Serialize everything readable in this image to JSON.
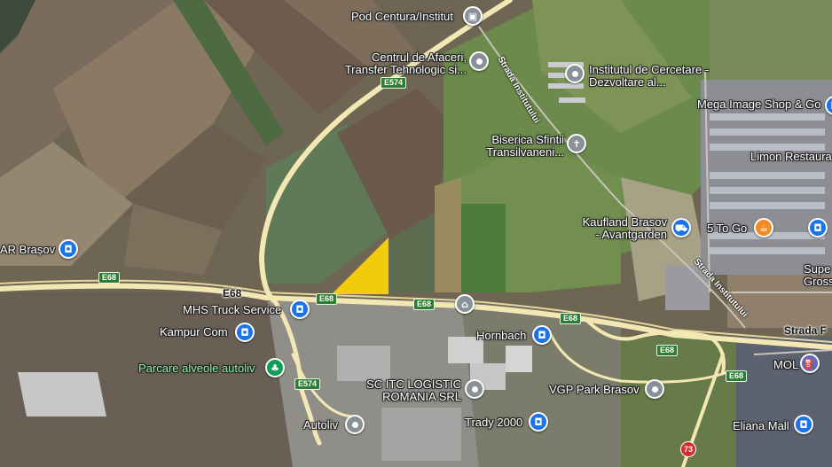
{
  "map": {
    "highlight_color": "#f2cc0c",
    "places": [
      {
        "id": "pod-centura",
        "label": "Pod Centura/Institut",
        "icon": "camera-icon",
        "color": "gray"
      },
      {
        "id": "centrul-afaceri",
        "label_lines": [
          "Centrul de Afaceri,",
          "Transfer Tehnologic si..."
        ],
        "icon": "pin-icon",
        "color": "gray"
      },
      {
        "id": "institutul",
        "label_lines": [
          "Institutul de Cercetare -",
          "Dezvoltare al..."
        ],
        "icon": "pin-icon",
        "color": "gray"
      },
      {
        "id": "mega-image",
        "label": "Mega Image Shop & Go",
        "icon": "shopping-bag-icon",
        "color": "blue"
      },
      {
        "id": "biserica",
        "label_lines": [
          "Biserica Sfintii",
          "Transilvaneni..."
        ],
        "icon": "cross-icon",
        "color": "gray"
      },
      {
        "id": "limon",
        "label": "Limon Restaura",
        "icon": "restaurant-icon",
        "color": "orange"
      },
      {
        "id": "kaufland",
        "label_lines": [
          "Kaufland Brasov",
          "- Avantgarden"
        ],
        "icon": "cart-icon",
        "color": "blue"
      },
      {
        "id": "5-to-go",
        "label": "5 To Go",
        "icon": "cafe-icon",
        "color": "orange"
      },
      {
        "id": "super-gross",
        "label_lines": [
          "Supe",
          "Gross&"
        ],
        "icon": "shopping-bag-icon",
        "color": "blue"
      },
      {
        "id": "ar-brasov",
        "label": "AR Brașov",
        "icon": "shopping-bag-icon",
        "color": "blue"
      },
      {
        "id": "mhs-truck",
        "label": "MHS Truck Service",
        "icon": "shopping-bag-icon",
        "color": "blue"
      },
      {
        "id": "kampur",
        "label": "Kampur Com",
        "icon": "shopping-bag-icon",
        "color": "blue"
      },
      {
        "id": "parcare",
        "label": "Parcare alveole autoliv",
        "icon": "tree-icon",
        "color": "green"
      },
      {
        "id": "school",
        "label": "",
        "icon": "graduation-cap-icon",
        "color": "gray"
      },
      {
        "id": "hornbach",
        "label": "Hornbach",
        "icon": "shopping-bag-icon",
        "color": "blue"
      },
      {
        "id": "mol",
        "label": "MOL",
        "icon": "gas-station-icon",
        "color": "purple"
      },
      {
        "id": "sc-itc",
        "label_lines": [
          "SC ITC LOGISTIC",
          "ROMANIA SRL"
        ],
        "icon": "pin-icon",
        "color": "gray"
      },
      {
        "id": "vgp-park",
        "label": "VGP Park Brasov",
        "icon": "pin-icon",
        "color": "gray"
      },
      {
        "id": "trady",
        "label": "Trady 2000",
        "icon": "shopping-bag-icon",
        "color": "blue"
      },
      {
        "id": "autoliv",
        "label": "Autoliv",
        "icon": "pin-icon",
        "color": "gray"
      },
      {
        "id": "eliana",
        "label": "Eliana Mall",
        "icon": "shopping-bag-icon",
        "color": "blue"
      }
    ],
    "road_shields": [
      {
        "id": "e574-top",
        "label": "E574"
      },
      {
        "id": "e68-left",
        "label": "E68"
      },
      {
        "id": "e68-mid",
        "label": "E68"
      },
      {
        "id": "e68-center",
        "label": "E68"
      },
      {
        "id": "e68-right1",
        "label": "E68"
      },
      {
        "id": "e68-right2",
        "label": "E68"
      },
      {
        "id": "e68-right3",
        "label": "E68"
      },
      {
        "id": "e574-bottom",
        "label": "E574"
      },
      {
        "id": "r73",
        "label": "73"
      }
    ],
    "road_labels": {
      "e68": "E68",
      "strada_f": "Strada F"
    },
    "street_labels": {
      "institutului_top": "Strada Institutului",
      "institutului_bottom": "Strada Institutului"
    }
  }
}
